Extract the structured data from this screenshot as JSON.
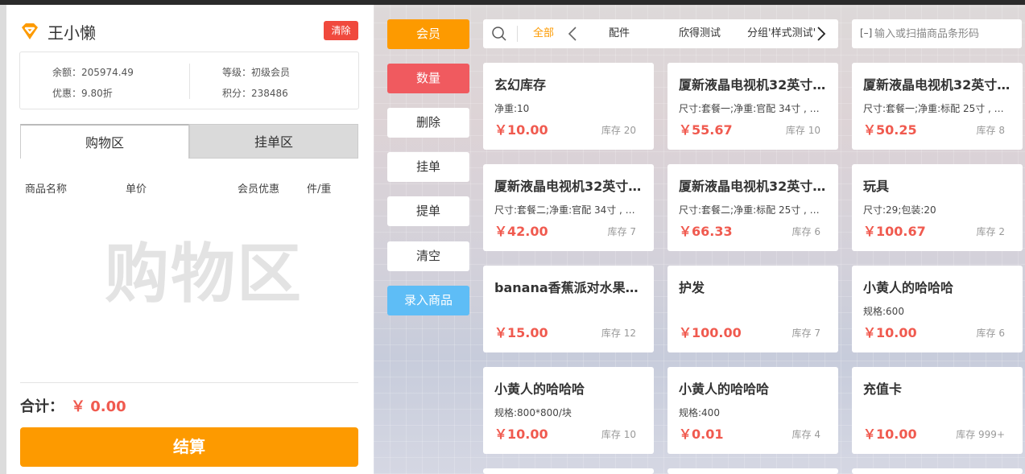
{
  "member": {
    "name": "王小懒",
    "clear_label": "清除",
    "balance": "余额：205974.49",
    "discount": "优惠：9.80折",
    "level": "等级：初级会员",
    "points": "积分：238486",
    "icon": "diamond-icon",
    "accent": "#fd9a00"
  },
  "tabs": [
    "购物区",
    "挂单区"
  ],
  "columns": [
    "商品名称",
    "单价",
    "会员优惠",
    "件/重"
  ],
  "cart_watermark": "购物区",
  "total": {
    "label": "合计：",
    "amount": "￥ 0.00"
  },
  "checkout_label": "结算",
  "operations": [
    "会员",
    "数量",
    "删除",
    "挂单",
    "提单",
    "清空",
    "录入商品"
  ],
  "categories": {
    "search_icon": "search-icon",
    "items": [
      "全部",
      "配件",
      "欣得测试",
      "分组'样式测试'"
    ],
    "prev_icon": "chevron-left-icon",
    "next_icon": "chevron-right-icon"
  },
  "barcode": {
    "icon_text": "[–]",
    "placeholder": "输入或扫描商品条形码"
  },
  "products": [
    {
      "name": "玄幻库存",
      "spec": "净重:10",
      "price": "￥10.00",
      "stock": "库存 20"
    },
    {
      "name": "厦新液晶电视机32英寸…",
      "spec": "尺寸:套餐一;净重:官配 34寸 , …",
      "price": "￥55.67",
      "stock": "库存 10"
    },
    {
      "name": "厦新液晶电视机32英寸…",
      "spec": "尺寸:套餐一;净重:标配 25寸 , …",
      "price": "￥50.25",
      "stock": "库存 8"
    },
    {
      "name": "厦新液晶电视机32英寸…",
      "spec": "尺寸:套餐二;净重:官配 34寸 , …",
      "price": "￥42.00",
      "stock": "库存 7"
    },
    {
      "name": "厦新液晶电视机32英寸…",
      "spec": "尺寸:套餐二;净重:标配 25寸 , …",
      "price": "￥66.33",
      "stock": "库存 6"
    },
    {
      "name": "玩具",
      "spec": "尺寸:29;包装:20",
      "price": "￥100.67",
      "stock": "库存 2"
    },
    {
      "name": "banana香蕉派对水果…",
      "spec": "",
      "price": "￥15.00",
      "stock": "库存 12"
    },
    {
      "name": "护发",
      "spec": "",
      "price": "￥100.00",
      "stock": "库存 7"
    },
    {
      "name": "小黄人的哈哈哈",
      "spec": "规格:600",
      "price": "￥10.00",
      "stock": "库存 6"
    },
    {
      "name": "小黄人的哈哈哈",
      "spec": "规格:800*800/块",
      "price": "￥10.00",
      "stock": "库存 10"
    },
    {
      "name": "小黄人的哈哈哈",
      "spec": "规格:400",
      "price": "￥0.01",
      "stock": "库存 4"
    },
    {
      "name": "充值卡",
      "spec": "",
      "price": "￥10.00",
      "stock": "库存 999+"
    }
  ]
}
